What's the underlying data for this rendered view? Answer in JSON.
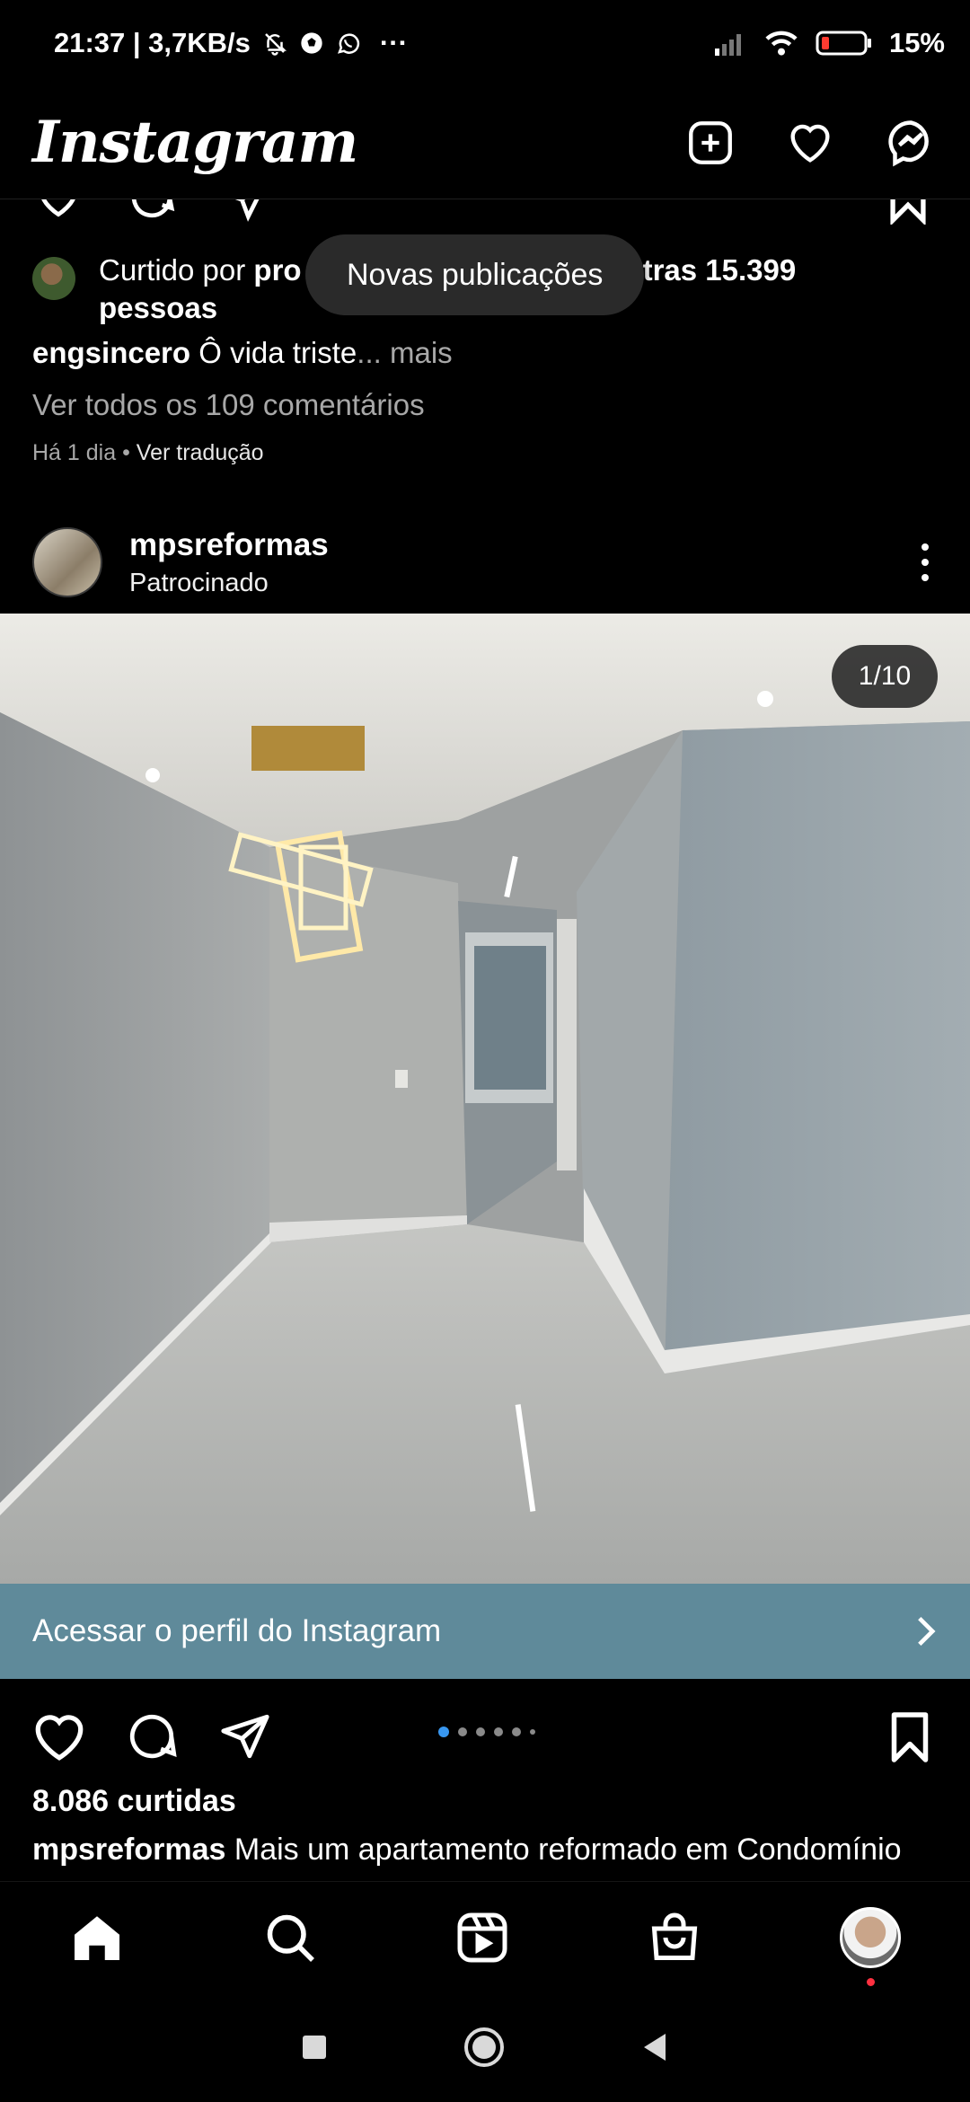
{
  "status_bar": {
    "time_speed": "21:37 | 3,7KB/s",
    "more": "···",
    "battery": "15%",
    "battery_color": "#ff3b30"
  },
  "top_bar": {
    "logo": "Instagram",
    "icons": [
      "new-post-icon",
      "activity-heart-icon",
      "messenger-icon"
    ]
  },
  "prev_post": {
    "liked_prefix": "Curtido por ",
    "liked_user_partial": "pro",
    "liked_suffix_partial": "tras 15.399",
    "liked_line2": "pessoas",
    "caption_user": "engsincero",
    "caption_text": " Ô vida triste",
    "caption_more": "... mais",
    "comments_link": "Ver todos os 109 comentários",
    "time": "Há 1 dia",
    "separator": " • ",
    "translate": "Ver tradução"
  },
  "toast": {
    "label": "Novas publicações"
  },
  "post": {
    "username": "mpsreformas",
    "subtitle": "Patrocinado",
    "counter": "1/10",
    "current_slide": 1,
    "total_slides": 10,
    "cta": "Acessar o perfil do Instagram",
    "cta_color": "#5f8a9a",
    "likes": "8.086 curtidas",
    "caption_user": "mpsreformas",
    "caption_text": " Mais um apartamento reformado em Condomínio"
  },
  "bottom_nav": {
    "items": [
      "home-icon",
      "search-icon",
      "reels-icon",
      "shop-icon",
      "profile-avatar"
    ]
  },
  "colors": {
    "background": "#000000",
    "muted_text": "#a8a8a8",
    "active_dot": "#3897f0",
    "notification_dot": "#ff3040"
  }
}
